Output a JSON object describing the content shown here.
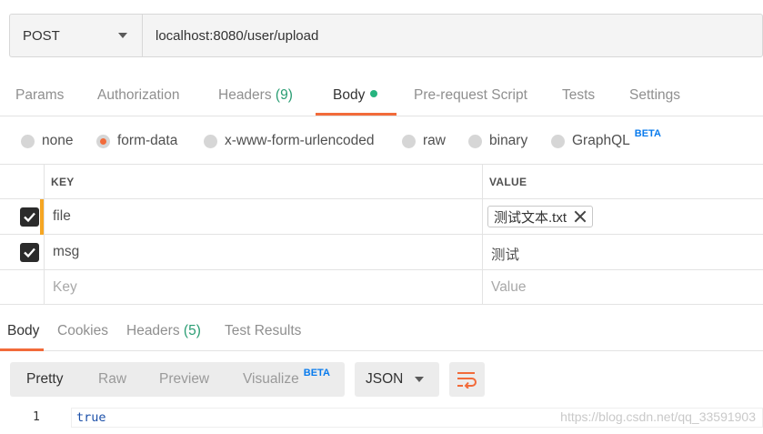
{
  "request": {
    "method": "POST",
    "url": "localhost:8080/user/upload"
  },
  "request_tabs": [
    {
      "label": "Params"
    },
    {
      "label": "Authorization"
    },
    {
      "label": "Headers",
      "count": "(9)"
    },
    {
      "label": "Body"
    },
    {
      "label": "Pre-request Script"
    },
    {
      "label": "Tests"
    },
    {
      "label": "Settings"
    }
  ],
  "body_types": {
    "none": "none",
    "form_data": "form-data",
    "urlencoded": "x-www-form-urlencoded",
    "raw": "raw",
    "binary": "binary",
    "graphql": "GraphQL",
    "beta": "BETA",
    "selected": "form-data"
  },
  "params_table": {
    "headers": {
      "key": "KEY",
      "value": "VALUE"
    },
    "rows": [
      {
        "checked": true,
        "key": "file",
        "value": "测试文本.txt"
      },
      {
        "checked": true,
        "key": "msg",
        "value": "测试"
      }
    ],
    "new_row": {
      "key_placeholder": "Key",
      "value_placeholder": "Value"
    }
  },
  "response_tabs": [
    {
      "label": "Body"
    },
    {
      "label": "Cookies"
    },
    {
      "label": "Headers",
      "count": "(5)"
    },
    {
      "label": "Test Results"
    }
  ],
  "response_view": {
    "modes": [
      "Pretty",
      "Raw",
      "Preview",
      "Visualize"
    ],
    "beta": "BETA",
    "language": "JSON"
  },
  "response_body": {
    "line_number": "1",
    "content": "true"
  },
  "watermark": "https://blog.csdn.net/qq_33591903",
  "colors": {
    "accent": "#f26b3a",
    "count_green": "#2a9d73",
    "beta_blue": "#097bed",
    "drag_marker": "#f5a623"
  }
}
